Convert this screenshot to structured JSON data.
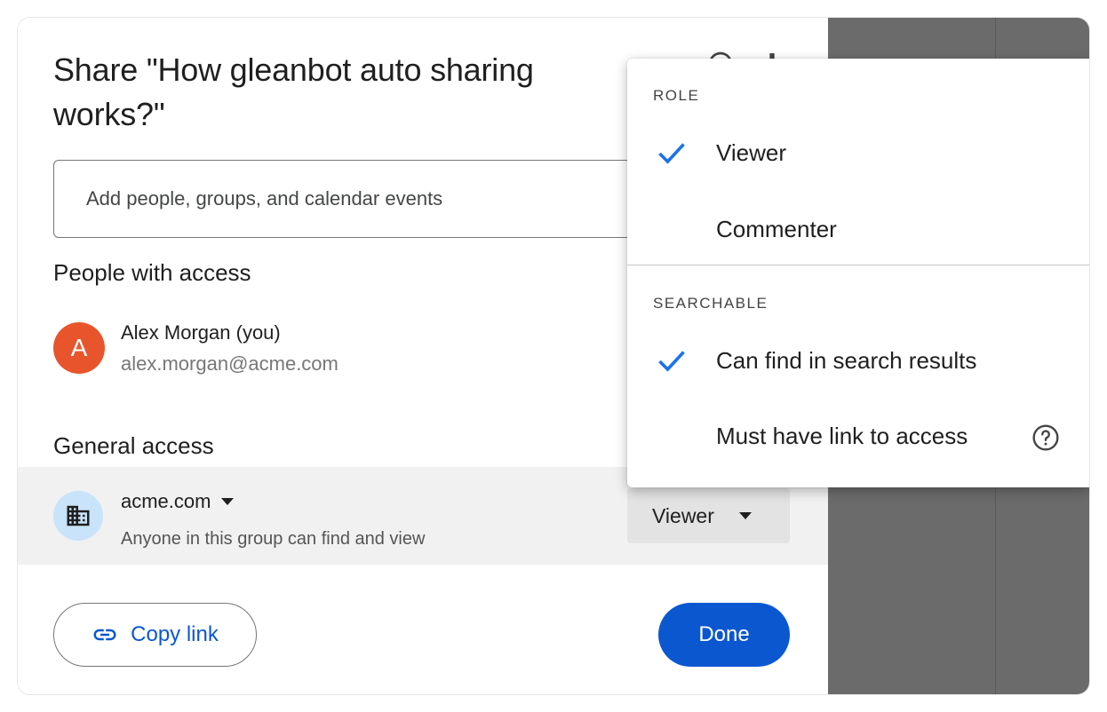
{
  "dialog": {
    "title": "Share \"How gleanbot auto sharing works?\"",
    "add_placeholder": "Add people, groups, and calendar events",
    "people_section": "People with access",
    "people": [
      {
        "initial": "A",
        "name": "Alex Morgan (you)",
        "email": "alex.morgan@acme.com",
        "avatar_color": "#e8552c"
      }
    ],
    "general_section": "General access",
    "general": {
      "domain": "acme.com",
      "description": "Anyone in this group can find and view",
      "role": "Viewer",
      "icon": "building-icon"
    },
    "copy_link_label": "Copy link",
    "done_label": "Done"
  },
  "menu": {
    "role_heading": "ROLE",
    "roles": [
      {
        "label": "Viewer",
        "checked": true
      },
      {
        "label": "Commenter",
        "checked": false
      }
    ],
    "searchable_heading": "SEARCHABLE",
    "searchable": [
      {
        "label": "Can find in search results",
        "checked": true
      },
      {
        "label": "Must have link to access",
        "checked": false,
        "help": true
      }
    ]
  },
  "colors": {
    "accent": "#0b57d0",
    "check": "#1a73e8",
    "backdrop": "#6b6b6b"
  }
}
